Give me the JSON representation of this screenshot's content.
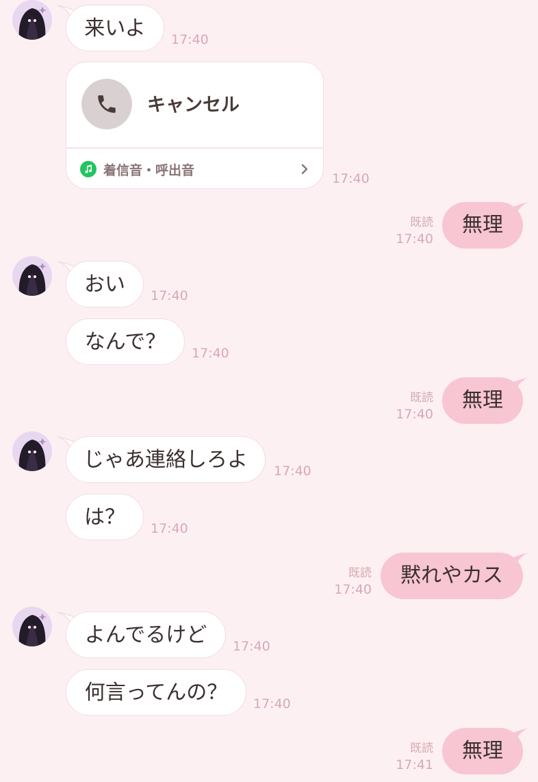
{
  "messages": [
    {
      "side": "in",
      "text": "来いよ",
      "time": "17:40"
    },
    {
      "side": "in",
      "type": "call",
      "title": "キャンセル",
      "sub": "着信音・呼出音",
      "time": "17:40"
    },
    {
      "side": "out",
      "text": "無理",
      "read": "既読",
      "time": "17:40"
    },
    {
      "side": "in",
      "text": "おい",
      "time": "17:40"
    },
    {
      "side": "in",
      "text": "なんで？",
      "time": "17:40"
    },
    {
      "side": "out",
      "text": "無理",
      "read": "既読",
      "time": "17:40"
    },
    {
      "side": "in",
      "text": "じゃあ連絡しろよ",
      "time": "17:40"
    },
    {
      "side": "in",
      "text": "は？",
      "time": "17:40"
    },
    {
      "side": "out",
      "text": "黙れやカス",
      "read": "既読",
      "time": "17:40"
    },
    {
      "side": "in",
      "text": "よんでるけど",
      "time": "17:40"
    },
    {
      "side": "in",
      "text": "何言ってんの？",
      "time": "17:40"
    },
    {
      "side": "out",
      "text": "無理",
      "read": "既読",
      "time": "17:41"
    }
  ],
  "icons": {
    "avatar": "avatar-image",
    "call": "phone-icon",
    "ringtone": "music-note-icon",
    "more": "chevron-right-icon"
  },
  "colors": {
    "background": "#fdf0f2",
    "incoming_bubble": "#ffffff",
    "outgoing_bubble": "#f7c6d2",
    "timestamp": "#d7a9b3",
    "ringtone_icon": "#22c55e"
  }
}
